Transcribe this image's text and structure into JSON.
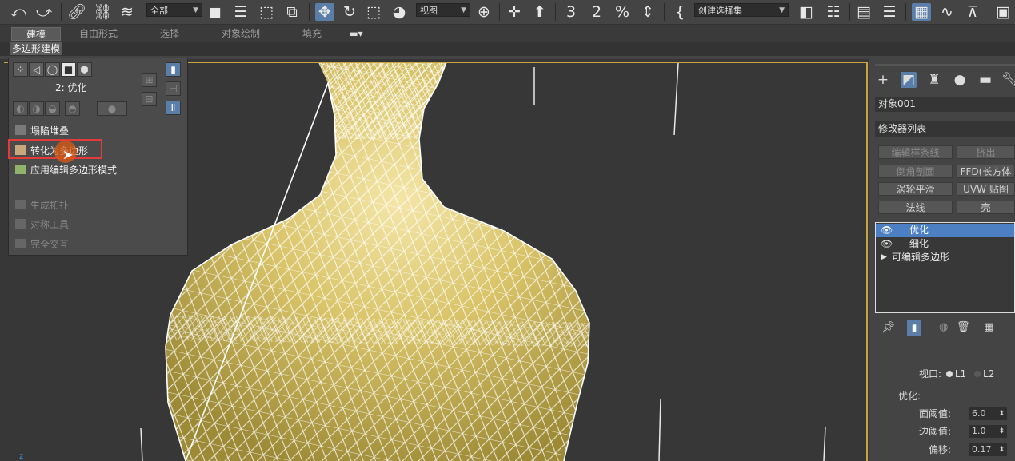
{
  "toolbar": {
    "selection_filter": "全部",
    "ref_coord": "视图",
    "named_selection": "创建选择集",
    "snap_label": "3",
    "angle_snap_label": "2",
    "percent_snap_label": "%"
  },
  "ribbon": {
    "tabs": [
      {
        "label": "建模",
        "active": true
      },
      {
        "label": "自由形式"
      },
      {
        "label": "选择"
      },
      {
        "label": "对象绘制"
      },
      {
        "label": "填充"
      }
    ],
    "sub_tab": "多边形建模"
  },
  "poly_panel": {
    "level_label": "2: 优化",
    "items": [
      {
        "label": "塌陷堆叠",
        "enabled": true
      },
      {
        "label": "转化为多边形",
        "enabled": true,
        "highlighted": true
      },
      {
        "label": "应用编辑多边形模式",
        "enabled": true
      },
      {
        "label": "生成拓扑",
        "enabled": false
      },
      {
        "label": "对称工具",
        "enabled": false
      },
      {
        "label": "完全交互",
        "enabled": false
      }
    ]
  },
  "command_panel": {
    "object_name": "对象001",
    "modifier_list": "修改器列表",
    "modifier_buttons": [
      {
        "label": "编辑样条线",
        "enabled": false
      },
      {
        "label": "挤出",
        "enabled": false
      },
      {
        "label": "倒角剖面",
        "enabled": false
      },
      {
        "label": "FFD(长方体",
        "enabled": true
      },
      {
        "label": "涡轮平滑",
        "enabled": true
      },
      {
        "label": "UVW 贴图",
        "enabled": true
      },
      {
        "label": "法线",
        "enabled": true
      },
      {
        "label": "壳",
        "enabled": true
      }
    ],
    "stack": [
      {
        "label": "优化",
        "selected": true,
        "eye": true
      },
      {
        "label": "细化",
        "selected": false,
        "eye": true
      },
      {
        "label": "可编辑多边形",
        "selected": false,
        "eye": false
      }
    ],
    "viewport_level": {
      "label": "视口:",
      "opt1": "L1",
      "opt2": "L2"
    },
    "optimize_group": "优化:",
    "params": [
      {
        "label": "面阈值:",
        "value": "6.0"
      },
      {
        "label": "边阈值:",
        "value": "1.0"
      },
      {
        "label": "偏移:",
        "value": "0.17"
      }
    ]
  },
  "colors": {
    "vase": "#d9c469",
    "wire": "#ffffff",
    "selection": "#4d80c3",
    "highlight": "#e23b3b",
    "viewport_border": "#c8a441"
  }
}
